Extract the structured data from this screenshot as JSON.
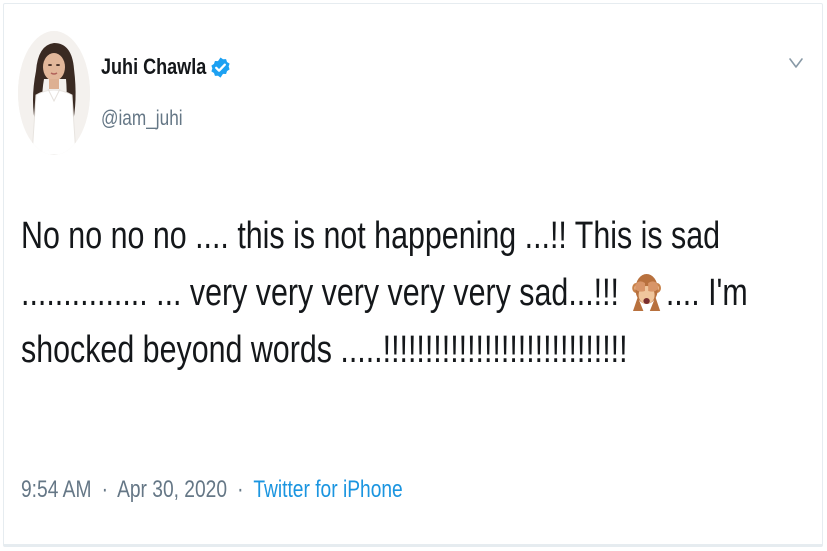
{
  "user": {
    "display_name": "Juhi Chawla",
    "handle": "@iam_juhi",
    "verified": true
  },
  "tweet": {
    "line_1": "No no no no .... this is not happening ...!! This is sad",
    "line_2a": "............... ... very very very very very sad...!!!",
    "line_2b": ".... I'm",
    "line_3": "shocked beyond words .....!!!!!!!!!!!!!!!!!!!!!!!!!!!!!",
    "emoji": "see-no-evil-monkey"
  },
  "meta": {
    "time": "9:54 AM",
    "separator": "·",
    "date": "Apr 30, 2020",
    "source": "Twitter for iPhone"
  },
  "colors": {
    "text": "#14171a",
    "secondary": "#657786",
    "link": "#1b95e0",
    "verified": "#1da1f2",
    "border": "#e6ecf0"
  },
  "icons": {
    "verified": "verified-badge-icon",
    "more": "chevron-down-icon"
  }
}
